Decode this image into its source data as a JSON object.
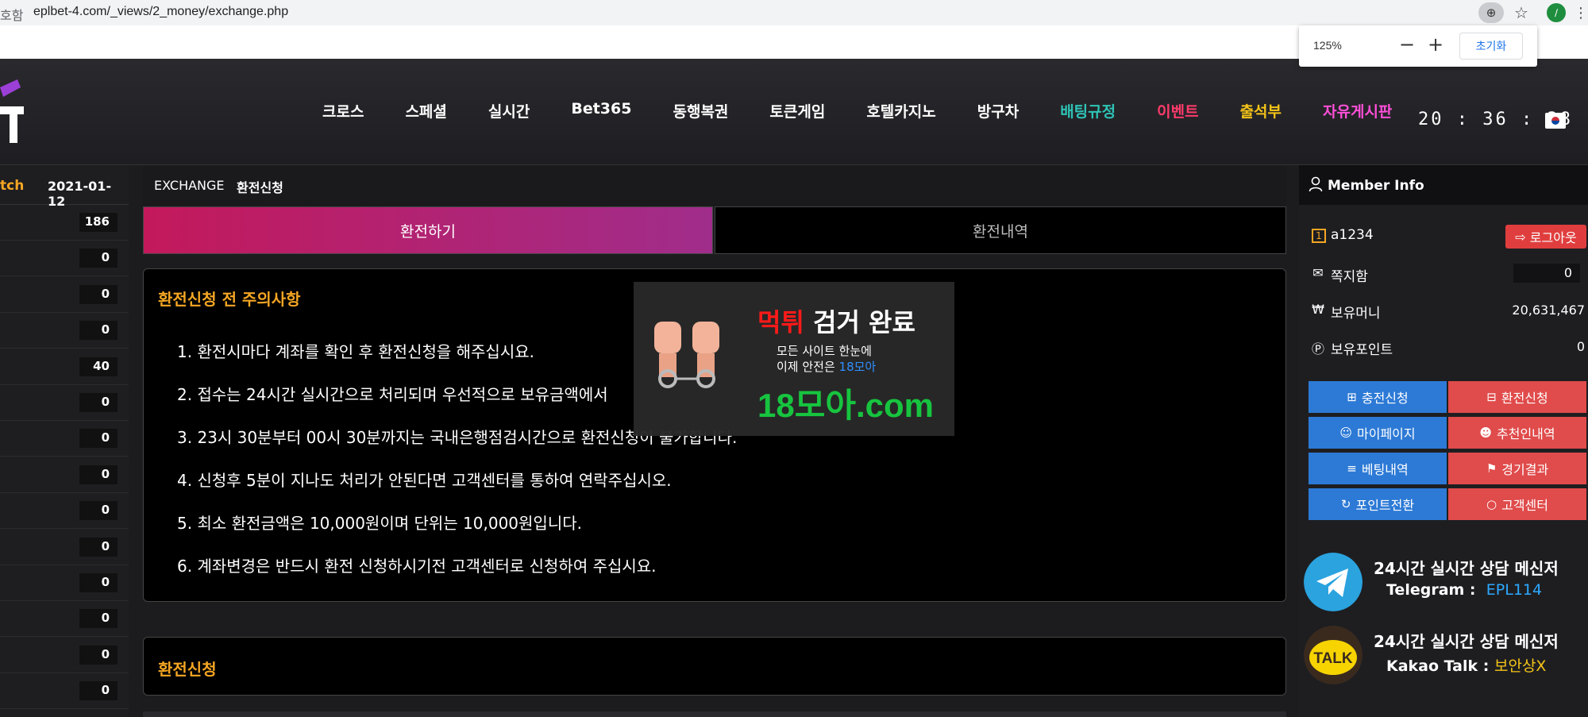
{
  "browser": {
    "url_prefix": "호함",
    "url": "eplbet-4.com/_views/2_money/exchange.php",
    "zoom_icon": "zoom-icon",
    "avatar_letter": "∕",
    "zoom_popup": {
      "value": "125%",
      "minus": "−",
      "plus": "+",
      "reset": "초기화"
    }
  },
  "header": {
    "nav": [
      {
        "label": "크로스",
        "color": "#ffffff"
      },
      {
        "label": "스페셜",
        "color": "#ffffff"
      },
      {
        "label": "실시간",
        "color": "#ffffff"
      },
      {
        "label": "Bet365",
        "color": "#ffffff"
      },
      {
        "label": "동행복권",
        "color": "#ffffff"
      },
      {
        "label": "토큰게임",
        "color": "#ffffff"
      },
      {
        "label": "호텔카지노",
        "color": "#ffffff"
      },
      {
        "label": "방구차",
        "color": "#ffffff"
      },
      {
        "label": "배팅규정",
        "color": "#2ec4b6"
      },
      {
        "label": "이벤트",
        "color": "#ff3b6b"
      },
      {
        "label": "출석부",
        "color": "#f5c518"
      },
      {
        "label": "자유게시판",
        "color": "#ff4fd8"
      }
    ],
    "clock": "20 : 36 : 38"
  },
  "left_sidebar": {
    "label": "tch",
    "date": "2021-01-12",
    "counts": [
      "186",
      "0",
      "0",
      "0",
      "40",
      "0",
      "0",
      "0",
      "0",
      "0",
      "0",
      "0",
      "0",
      "0"
    ]
  },
  "main": {
    "breadcrumb_en": "EXCHANGE",
    "breadcrumb_ko": "환전신청",
    "tabs": {
      "active": "환전하기",
      "other": "환전내역"
    },
    "notice": {
      "title": "환전신청 전 주의사항",
      "items": [
        "1. 환전시마다 계좌를 확인 후 환전신청을 해주십시요.",
        "2. 접수는 24시간 실시간으로 처리되며 우선적으로 보유금액에서",
        "3. 23시 30분부터 00시 30분까지는 국내은행점검시간으로 환전신청이 불가합니다.",
        "4. 신청후 5분이 지나도 처리가 안된다면 고객센터를 통하여 연락주십시오.",
        "5. 최소 환전금액은 10,000원이며 단위는 10,000원입니다.",
        "6. 계좌변경은 반드시 환전 신청하시기전 고객센터로 신청하여 주십시요."
      ]
    },
    "apply_title": "환전신청"
  },
  "overlay": {
    "title_red": "먹튀",
    "title_white": " 검거 완료",
    "sub1": "모든 사이트 한눈에",
    "sub2_prefix": "이제 안전은 ",
    "sub2_blue": "18모아",
    "domain": "18모아.com"
  },
  "member": {
    "title": "Member Info",
    "username": "a1234",
    "logout": "로그아웃",
    "message_label": "쪽지함",
    "message_count": "0",
    "money_label": "보유머니",
    "money_value": "20,631,467",
    "point_label": "보유포인트",
    "point_value": "0",
    "buttons": [
      {
        "label": "충전신청",
        "icon": "⊞",
        "color": "blue"
      },
      {
        "label": "환전신청",
        "icon": "⊟",
        "color": "red"
      },
      {
        "label": "마이페이지",
        "icon": "☺",
        "color": "blue"
      },
      {
        "label": "추천인내역",
        "icon": "☻",
        "color": "red"
      },
      {
        "label": "베팅내역",
        "icon": "≡",
        "color": "blue"
      },
      {
        "label": "경기결과",
        "icon": "⚑",
        "color": "red"
      },
      {
        "label": "포인트전환",
        "icon": "↻",
        "color": "blue"
      },
      {
        "label": "고객센터",
        "icon": "○",
        "color": "red"
      }
    ]
  },
  "contacts": {
    "telegram": {
      "line1": "24시간 실시간 상담 메신저",
      "label": "Telegram : ",
      "id": "EPL114"
    },
    "kakao": {
      "line1": "24시간 실시간 상담 메신저",
      "label": "Kakao Talk : ",
      "id": "보안상X",
      "icon_text": "TALK"
    }
  }
}
